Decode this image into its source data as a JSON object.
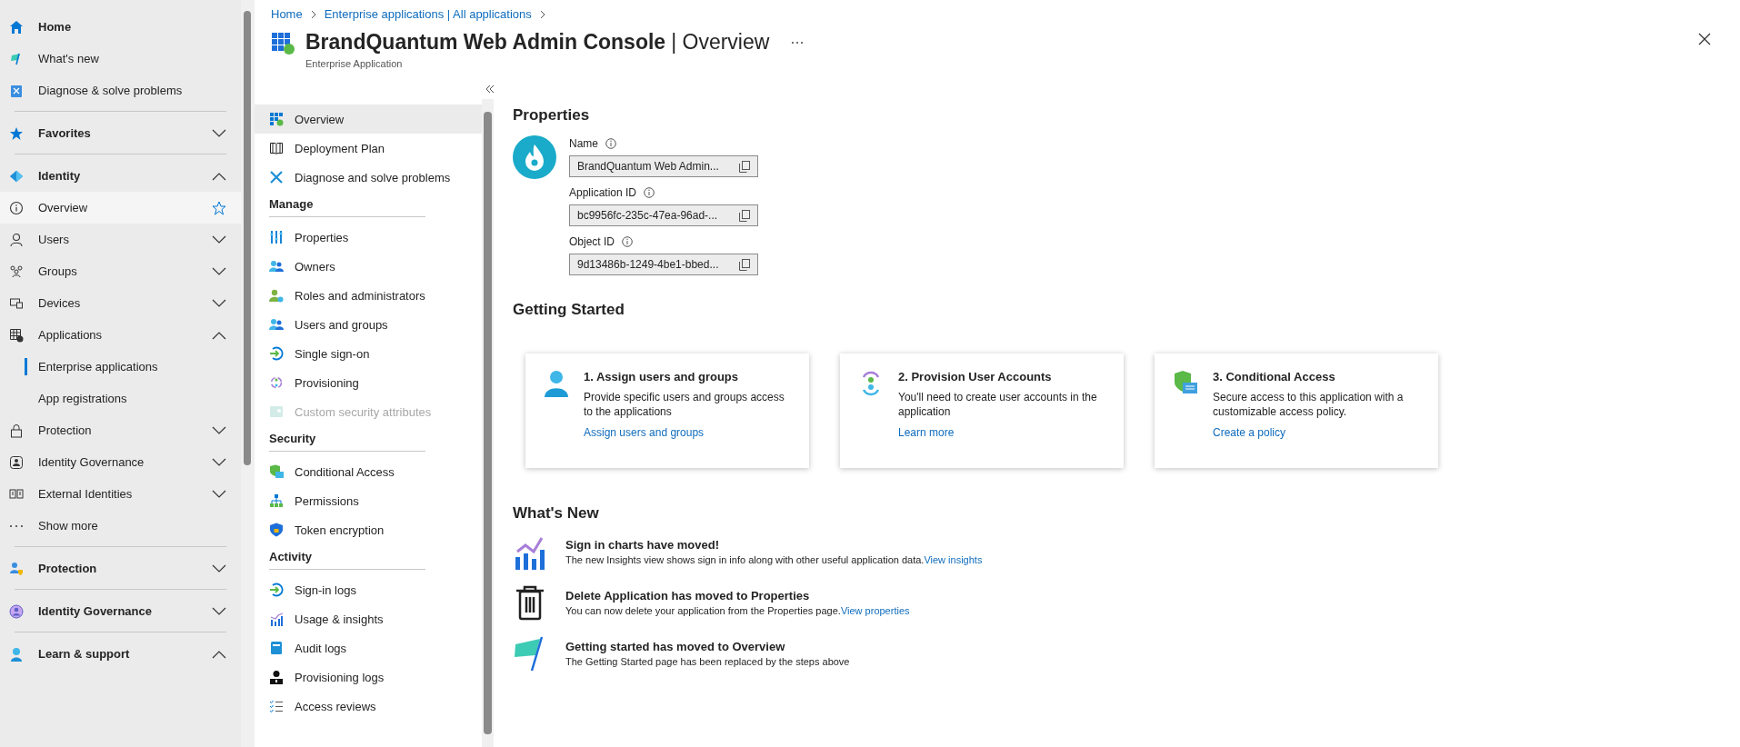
{
  "left_nav": {
    "items": [
      {
        "label": "Home",
        "kind": "top",
        "selected": false,
        "highlighted": false,
        "divider_before": false
      },
      {
        "label": "What's new",
        "kind": "link",
        "selected": false,
        "highlighted": false,
        "divider_before": false
      },
      {
        "label": "Diagnose & solve problems",
        "kind": "link",
        "selected": false,
        "highlighted": false,
        "divider_before": false
      },
      {
        "label": "Favorites",
        "kind": "section",
        "expanded": false,
        "selected": false,
        "highlighted": false,
        "divider_before": true
      },
      {
        "label": "Identity",
        "kind": "section",
        "expanded": true,
        "selected": false,
        "highlighted": false,
        "divider_before": true
      },
      {
        "label": "Overview",
        "kind": "link",
        "selected": false,
        "highlighted": true,
        "divider_before": false
      },
      {
        "label": "Users",
        "kind": "category",
        "expanded": false,
        "selected": false,
        "highlighted": false,
        "divider_before": false
      },
      {
        "label": "Groups",
        "kind": "category",
        "expanded": false,
        "selected": false,
        "highlighted": false,
        "divider_before": false
      },
      {
        "label": "Devices",
        "kind": "category",
        "expanded": false,
        "selected": false,
        "highlighted": false,
        "divider_before": false
      },
      {
        "label": "Applications",
        "kind": "category",
        "expanded": true,
        "selected": false,
        "highlighted": false,
        "divider_before": false
      },
      {
        "label": "Enterprise applications",
        "kind": "sub",
        "selected": true,
        "highlighted": false,
        "divider_before": false
      },
      {
        "label": "App registrations",
        "kind": "sub",
        "selected": false,
        "highlighted": false,
        "divider_before": false
      },
      {
        "label": "Protection",
        "kind": "category",
        "expanded": false,
        "selected": false,
        "highlighted": false,
        "divider_before": false
      },
      {
        "label": "Identity Governance",
        "kind": "category",
        "expanded": false,
        "selected": false,
        "highlighted": false,
        "divider_before": false
      },
      {
        "label": "External Identities",
        "kind": "category",
        "expanded": false,
        "selected": false,
        "highlighted": false,
        "divider_before": false
      },
      {
        "label": "Show more",
        "kind": "link",
        "selected": false,
        "highlighted": false,
        "divider_before": false
      },
      {
        "label": "Protection",
        "kind": "section",
        "expanded": false,
        "selected": false,
        "highlighted": false,
        "divider_before": true
      },
      {
        "label": "Identity Governance",
        "kind": "section",
        "expanded": false,
        "selected": false,
        "highlighted": false,
        "divider_before": true
      },
      {
        "label": "Learn & support",
        "kind": "section",
        "expanded": true,
        "selected": false,
        "highlighted": false,
        "divider_before": true
      }
    ]
  },
  "breadcrumb": [
    "Home",
    "Enterprise applications | All applications"
  ],
  "header": {
    "title": "BrandQuantum Web Admin Console",
    "page": "| Overview",
    "subtitle": "Enterprise Application"
  },
  "resource_menu": {
    "sections": [
      {
        "items": [
          {
            "label": "Overview",
            "selected": true,
            "disabled": false
          },
          {
            "label": "Deployment Plan",
            "selected": false,
            "disabled": false
          },
          {
            "label": "Diagnose and solve problems",
            "selected": false,
            "disabled": false
          }
        ]
      },
      {
        "heading": "Manage",
        "items": [
          {
            "label": "Properties",
            "selected": false,
            "disabled": false
          },
          {
            "label": "Owners",
            "selected": false,
            "disabled": false
          },
          {
            "label": "Roles and administrators",
            "selected": false,
            "disabled": false
          },
          {
            "label": "Users and groups",
            "selected": false,
            "disabled": false
          },
          {
            "label": "Single sign-on",
            "selected": false,
            "disabled": false
          },
          {
            "label": "Provisioning",
            "selected": false,
            "disabled": false
          },
          {
            "label": "Custom security attributes",
            "selected": false,
            "disabled": true
          }
        ]
      },
      {
        "heading": "Security",
        "items": [
          {
            "label": "Conditional Access",
            "selected": false,
            "disabled": false
          },
          {
            "label": "Permissions",
            "selected": false,
            "disabled": false
          },
          {
            "label": "Token encryption",
            "selected": false,
            "disabled": false
          }
        ]
      },
      {
        "heading": "Activity",
        "items": [
          {
            "label": "Sign-in logs",
            "selected": false,
            "disabled": false
          },
          {
            "label": "Usage & insights",
            "selected": false,
            "disabled": false
          },
          {
            "label": "Audit logs",
            "selected": false,
            "disabled": false
          },
          {
            "label": "Provisioning logs",
            "selected": false,
            "disabled": false
          },
          {
            "label": "Access reviews",
            "selected": false,
            "disabled": false
          }
        ]
      }
    ]
  },
  "properties": {
    "heading": "Properties",
    "fields": [
      {
        "label": "Name",
        "value": "BrandQuantum Web Admin..."
      },
      {
        "label": "Application ID",
        "value": "bc9956fc-235c-47ea-96ad-..."
      },
      {
        "label": "Object ID",
        "value": "9d13486b-1249-4be1-bbed..."
      }
    ]
  },
  "getting_started": {
    "heading": "Getting Started",
    "cards": [
      {
        "title": "1. Assign users and groups",
        "description": "Provide specific users and groups access to the applications",
        "link": "Assign users and groups"
      },
      {
        "title": "2. Provision User Accounts",
        "description": "You'll need to create user accounts in the application",
        "link": "Learn more"
      },
      {
        "title": "3. Conditional Access",
        "description": "Secure access to this application with a customizable access policy.",
        "link": "Create a policy"
      }
    ]
  },
  "whats_new": {
    "heading": "What's New",
    "items": [
      {
        "title": "Sign in charts have moved!",
        "text": "The new Insights view shows sign in info along with other useful application data.",
        "link": "View insights"
      },
      {
        "title": "Delete Application has moved to Properties",
        "text": "You can now delete your application from the Properties page.",
        "link": "View properties"
      },
      {
        "title": "Getting started has moved to Overview",
        "text": "The Getting Started page has been replaced by the steps above"
      }
    ]
  }
}
